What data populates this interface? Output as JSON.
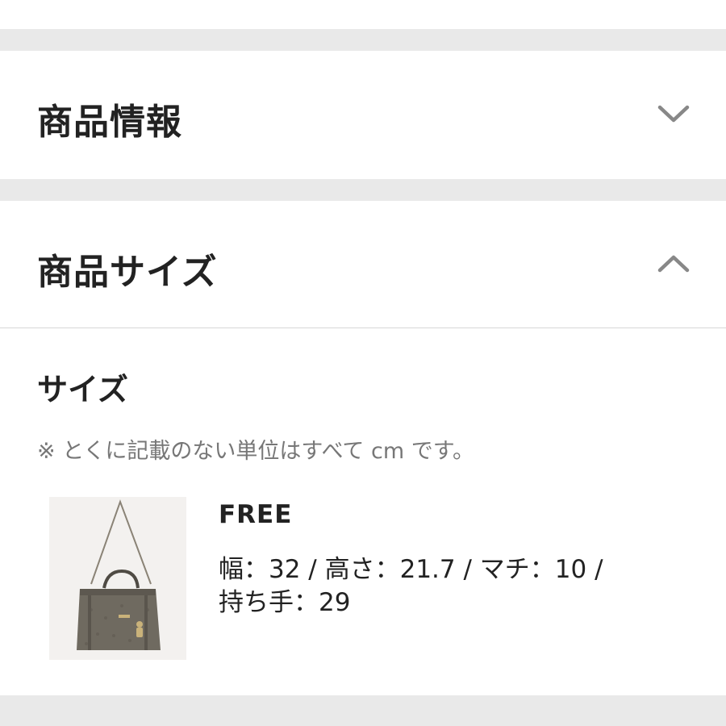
{
  "sections": {
    "product_info": {
      "title": "商品情報",
      "state": "collapsed",
      "chevron": "chevron-down-icon"
    },
    "product_size": {
      "title": "商品サイズ",
      "state": "expanded",
      "chevron": "chevron-up-icon",
      "heading": "サイズ",
      "note": "※ とくに記載のない単位はすべて cm です。",
      "variants": [
        {
          "label": "FREE",
          "dimensions_line1": "幅：32 / 高さ：21.7 / マチ：10 /",
          "dimensions_line2": "持ち手：29",
          "image": "bag-thumbnail"
        }
      ]
    }
  },
  "colors": {
    "band": "#e9e9e9",
    "text": "#222222",
    "muted_text": "#777777",
    "chevron": "#888888",
    "divider": "#d6d6d6"
  }
}
